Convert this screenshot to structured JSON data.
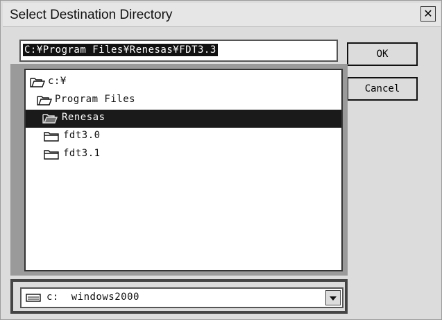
{
  "window": {
    "title": "Select Destination Directory",
    "close_glyph": "✕"
  },
  "path": {
    "value": "C:¥Program Files¥Renesas¥FDT3.3"
  },
  "buttons": {
    "ok": "OK",
    "cancel": "Cancel"
  },
  "tree": {
    "items": [
      {
        "label": "c:¥",
        "icon": "open-folder-icon",
        "selected": false
      },
      {
        "label": "Program Files",
        "icon": "open-folder-icon",
        "selected": false
      },
      {
        "label": "Renesas",
        "icon": "open-folder-icon",
        "selected": true
      },
      {
        "label": "fdt3.0",
        "icon": "closed-folder-icon",
        "selected": false
      },
      {
        "label": "fdt3.1",
        "icon": "closed-folder-icon",
        "selected": false
      }
    ]
  },
  "drive": {
    "value": "c:  windows2000",
    "icon": "drive-icon",
    "arrow_icon": "chevron-down-icon"
  },
  "colors": {
    "selection": "#1a1a1a",
    "selection_text": "#ffffff"
  }
}
